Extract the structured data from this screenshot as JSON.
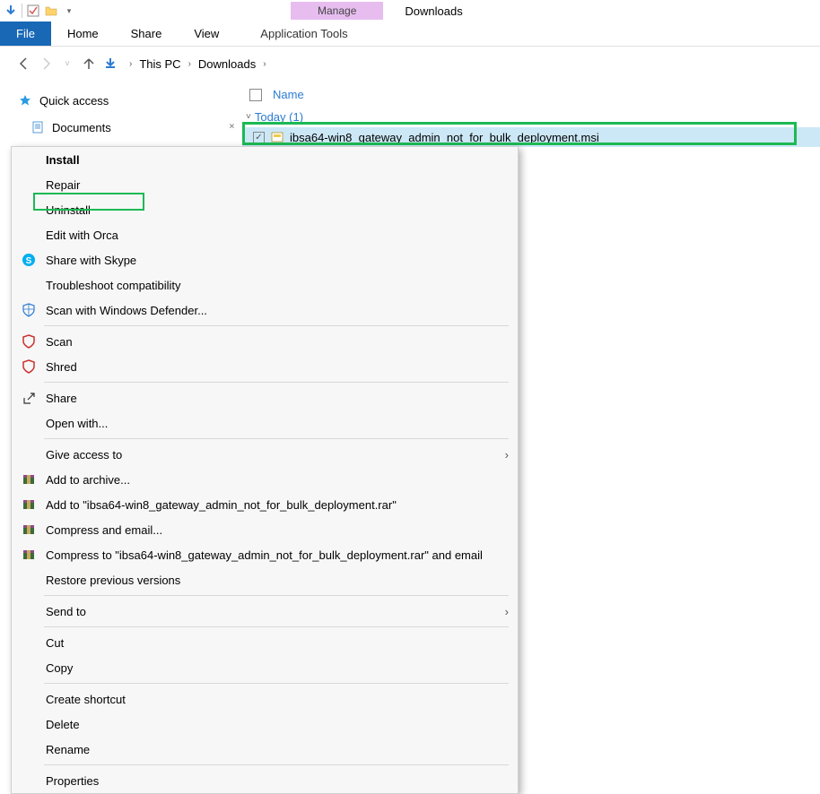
{
  "titlebar": {
    "manage_label": "Manage",
    "window_title": "Downloads"
  },
  "ribbon": {
    "file": "File",
    "home": "Home",
    "share": "Share",
    "view": "View",
    "app_tools": "Application Tools"
  },
  "breadcrumb": {
    "root": "This PC",
    "folder": "Downloads"
  },
  "sidebar": {
    "quick_access": "Quick access",
    "documents": "Documents"
  },
  "content": {
    "column_name": "Name",
    "group_today": "Today (1)",
    "file_name": "ibsa64-win8_gateway_admin_not_for_bulk_deployment.msi"
  },
  "context_menu": {
    "install": "Install",
    "repair": "Repair",
    "uninstall": "Uninstall",
    "edit_orca": "Edit with Orca",
    "share_skype": "Share with Skype",
    "troubleshoot": "Troubleshoot compatibility",
    "defender": "Scan with Windows Defender...",
    "scan": "Scan",
    "shred": "Shred",
    "share": "Share",
    "open_with": "Open with...",
    "give_access": "Give access to",
    "add_archive": "Add to archive...",
    "add_to_rar": "Add to \"ibsa64-win8_gateway_admin_not_for_bulk_deployment.rar\"",
    "compress_email": "Compress and email...",
    "compress_to_email": "Compress to \"ibsa64-win8_gateway_admin_not_for_bulk_deployment.rar\" and email",
    "restore": "Restore previous versions",
    "send_to": "Send to",
    "cut": "Cut",
    "copy": "Copy",
    "create_shortcut": "Create shortcut",
    "delete": "Delete",
    "rename": "Rename",
    "properties": "Properties"
  }
}
